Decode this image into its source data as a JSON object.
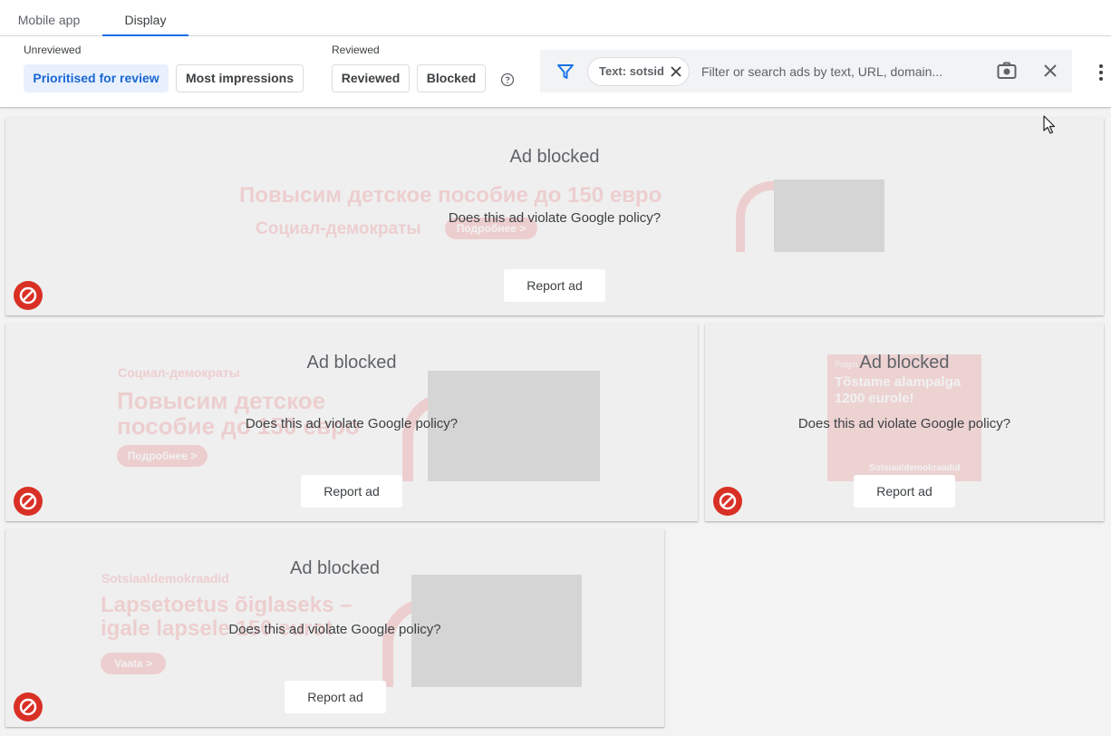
{
  "tabs": [
    {
      "label": "Mobile app",
      "active": false
    },
    {
      "label": "Display",
      "active": true
    }
  ],
  "filters": {
    "unreviewed_label": "Unreviewed",
    "reviewed_label": "Reviewed",
    "chips": [
      "Prioritised for review",
      "Most impressions",
      "Reviewed",
      "Blocked"
    ],
    "selected_chip": "Prioritised for review"
  },
  "search": {
    "text_chip": "Text: sotsid",
    "placeholder": "Filter or search ads by text, URL, domain..."
  },
  "card_common": {
    "title": "Ad blocked",
    "question": "Does this ad violate Google policy?",
    "report_label": "Report ad"
  },
  "ads": [
    {
      "headline": "Повысим детское пособие до 150 евро",
      "brand": "Социал-демократы",
      "cta": "Подробнее >"
    },
    {
      "brand": "Социал-демократы",
      "headline_line1": "Повысим детское",
      "headline_line2": "пособие до 150 евро",
      "cta": "Подробнее >"
    },
    {
      "top": "Polgm",
      "headline_line1": "Tõstame alampalga",
      "headline_line2": "1200 eurole!",
      "brand": "Sotsiaaldemokraadid"
    },
    {
      "brand": "Sotsiaaldemokraadid",
      "headline_line1": "Lapsetoetus õiglaseks –",
      "headline_line2": "igale lapsele 150 eurot",
      "cta": "Vaata >"
    }
  ],
  "colors": {
    "accent": "#1a73e8",
    "block_red": "#d93025",
    "ad_red": "#e8272c"
  }
}
